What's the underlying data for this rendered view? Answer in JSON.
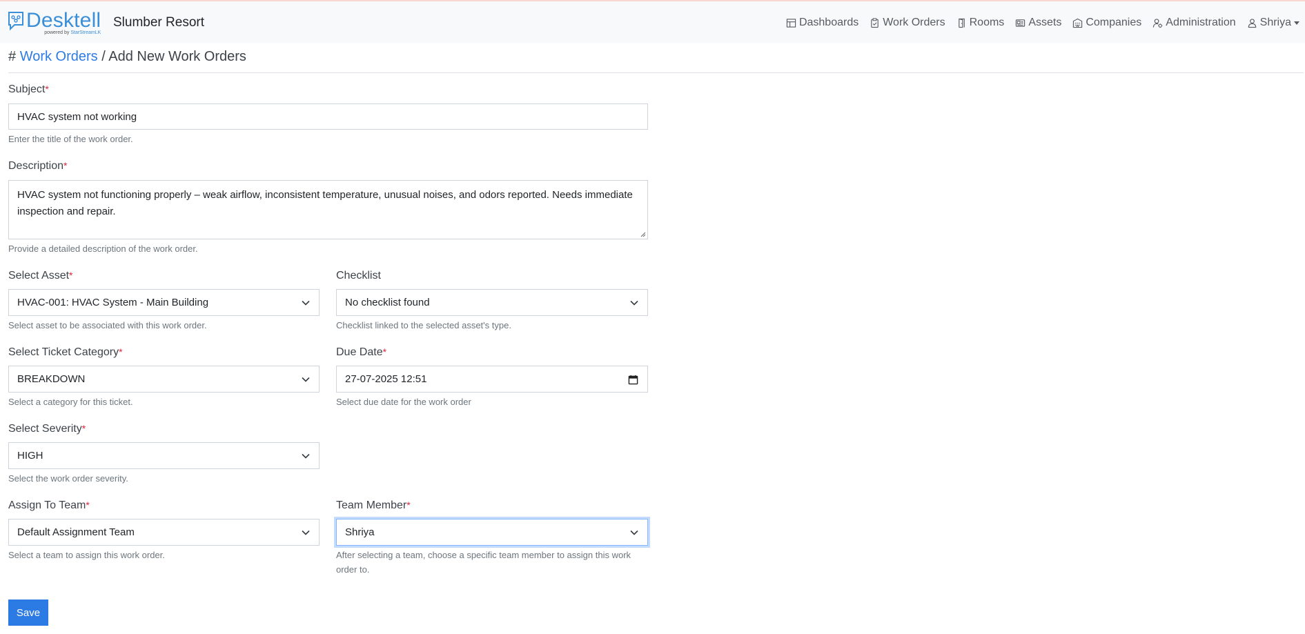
{
  "brand": {
    "name": "Desktell",
    "tagline_prefix": "powered by",
    "tagline_company": "StarStreamLK",
    "property": "Slumber Resort"
  },
  "nav": {
    "items": [
      {
        "label": "Dashboards",
        "icon": "dashboard-icon"
      },
      {
        "label": "Work Orders",
        "icon": "clipboard-icon"
      },
      {
        "label": "Rooms",
        "icon": "door-icon"
      },
      {
        "label": "Assets",
        "icon": "assets-icon"
      },
      {
        "label": "Companies",
        "icon": "building-icon"
      },
      {
        "label": "Administration",
        "icon": "admin-icon"
      }
    ],
    "user": "Shriya"
  },
  "breadcrumb": {
    "hash": "#",
    "link": "Work Orders",
    "current": "/ Add New Work Orders"
  },
  "form": {
    "subject": {
      "label": "Subject",
      "value": "HVAC system not working",
      "help": "Enter the title of the work order."
    },
    "description": {
      "label": "Description",
      "value": "HVAC system not functioning properly – weak airflow, inconsistent temperature, unusual noises, and odors reported. Needs immediate inspection and repair.",
      "help": "Provide a detailed description of the work order."
    },
    "asset": {
      "label": "Select Asset",
      "value": "HVAC-001: HVAC System - Main Building",
      "help": "Select asset to be associated with this work order."
    },
    "checklist": {
      "label": "Checklist",
      "value": "No checklist found",
      "help": "Checklist linked to the selected asset's type."
    },
    "category": {
      "label": "Select Ticket Category",
      "value": "BREAKDOWN",
      "help": "Select a category for this ticket."
    },
    "due_date": {
      "label": "Due Date",
      "value": "27-07-2025 12:51",
      "help": "Select due date for the work order"
    },
    "severity": {
      "label": "Select Severity",
      "value": "HIGH",
      "help": "Select the work order severity."
    },
    "team": {
      "label": "Assign To Team",
      "value": "Default Assignment Team",
      "help": "Select a team to assign this work order."
    },
    "member": {
      "label": "Team Member",
      "value": "Shriya",
      "help": "After selecting a team, choose a specific team member to assign this work order to."
    },
    "required_mark": "*",
    "save_label": "Save"
  },
  "colors": {
    "primary": "#2c7be5",
    "required": "#e0243b",
    "brand": "#3a8fd8"
  }
}
